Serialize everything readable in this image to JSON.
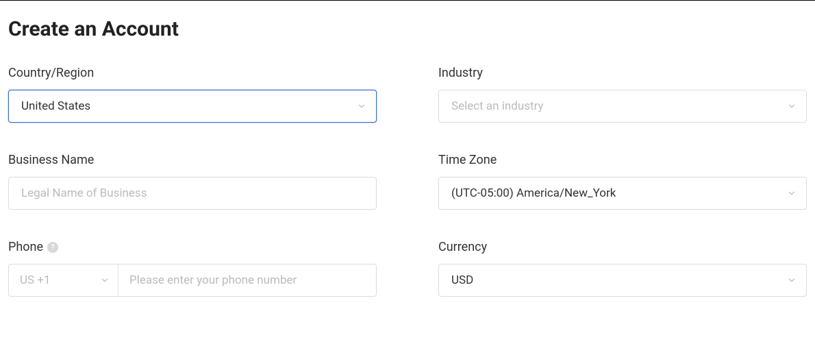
{
  "title": "Create an Account",
  "fields": {
    "country": {
      "label": "Country/Region",
      "value": "United States"
    },
    "industry": {
      "label": "Industry",
      "placeholder": "Select an industry"
    },
    "businessName": {
      "label": "Business Name",
      "placeholder": "Legal Name of Business"
    },
    "timezone": {
      "label": "Time Zone",
      "value": "(UTC-05:00) America/New_York"
    },
    "phone": {
      "label": "Phone",
      "prefix": "US +1",
      "placeholder": "Please enter your phone number",
      "help": "?"
    },
    "currency": {
      "label": "Currency",
      "value": "USD"
    }
  }
}
